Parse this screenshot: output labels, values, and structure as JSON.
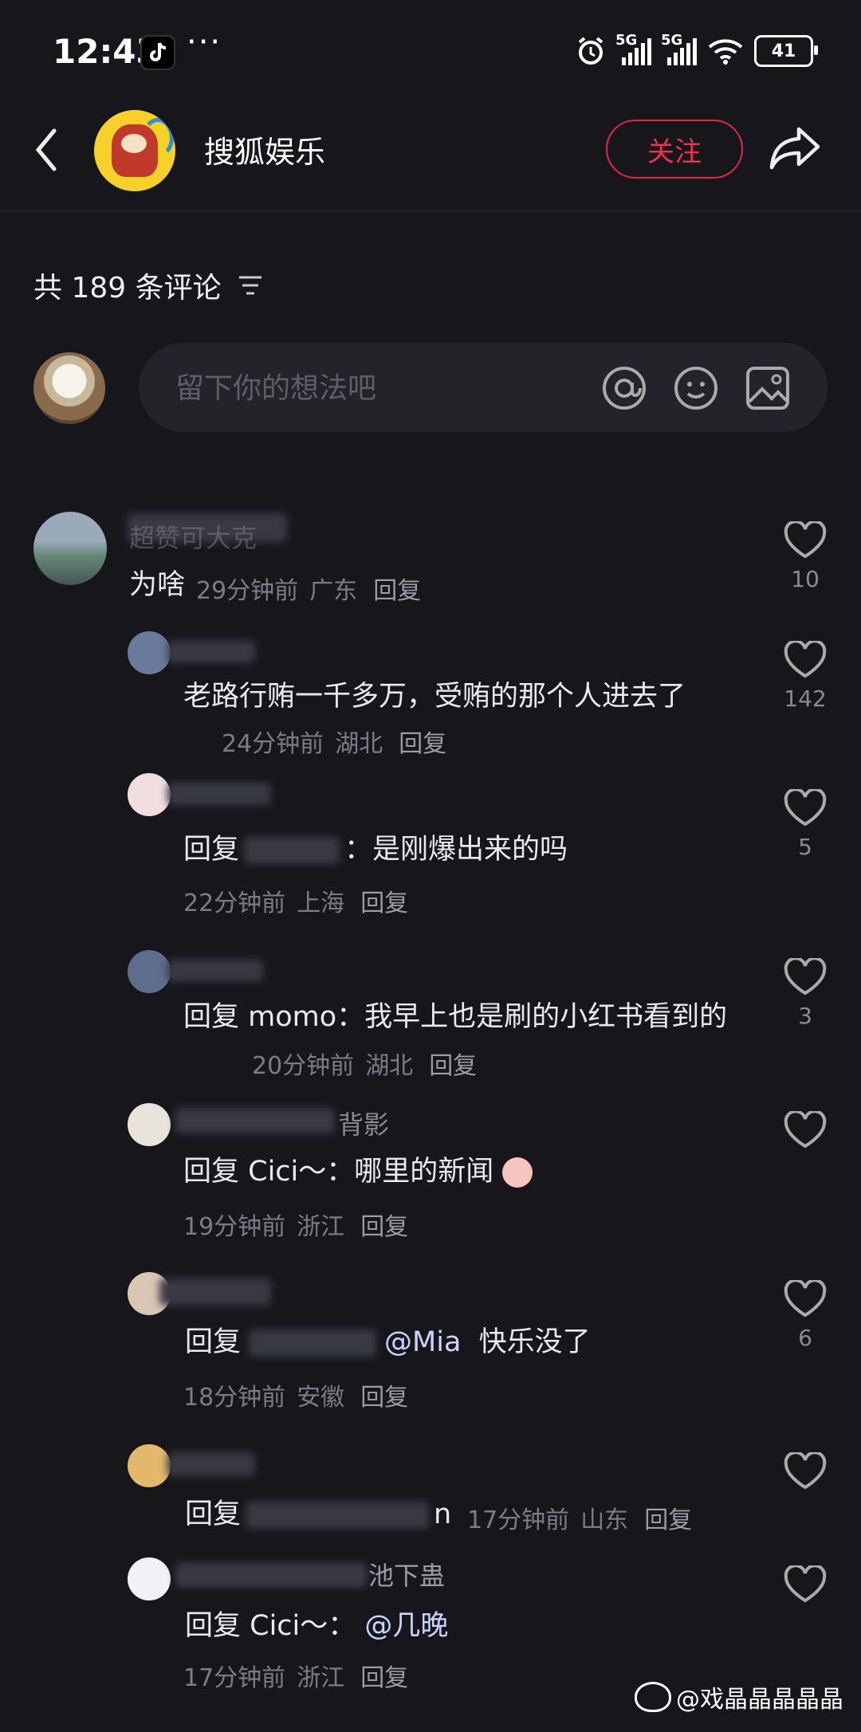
{
  "status_bar": {
    "time": "12:43",
    "dots": "···",
    "net1": "5G",
    "net2": "5G",
    "battery": "41"
  },
  "header": {
    "account_name": "搜狐娱乐",
    "follow_label": "关注"
  },
  "comments_header": {
    "count_text": "共 189 条评论"
  },
  "composer": {
    "placeholder": "留下你的想法吧"
  },
  "comments": [
    {
      "name": "超赞可大克",
      "text": "为啥",
      "time": "29分钟前",
      "region": "广东",
      "reply": "回复",
      "likes": "10"
    },
    {
      "name": "",
      "text": "老路行贿一千多万，受贿的那个人进去了",
      "time": "24分钟前",
      "region": "湖北",
      "reply": "回复",
      "likes": "142"
    },
    {
      "name": "",
      "text_prefix": "回复",
      "text": "：是刚爆出来的吗",
      "time": "22分钟前",
      "region": "上海",
      "reply": "回复",
      "likes": "5"
    },
    {
      "name": "",
      "text_prefix": "回复 momo：",
      "text": "我早上也是刷的小红书看到的",
      "time": "20分钟前",
      "region": "湖北",
      "reply": "回复",
      "likes": "3"
    },
    {
      "name": "背影",
      "text_prefix": "回复 Cici～：",
      "text": "哪里的新闻",
      "time": "19分钟前",
      "region": "浙江",
      "reply": "回复",
      "likes": ""
    },
    {
      "name": "",
      "text_prefix": "回复",
      "mention": "@Mia",
      "text": "快乐没了",
      "time": "18分钟前",
      "region": "安徽",
      "reply": "回复",
      "likes": "6"
    },
    {
      "name": "",
      "text_prefix": "回复",
      "text": "n",
      "time": "17分钟前",
      "region": "山东",
      "reply": "回复",
      "likes": ""
    },
    {
      "name": "池下蛊",
      "text_prefix": "回复 Cici～：",
      "mention": "@几晚",
      "text": "",
      "time": "17分钟前",
      "region": "浙江",
      "reply": "回复",
      "likes": ""
    }
  ],
  "watermark": "@戏晶晶晶晶晶"
}
